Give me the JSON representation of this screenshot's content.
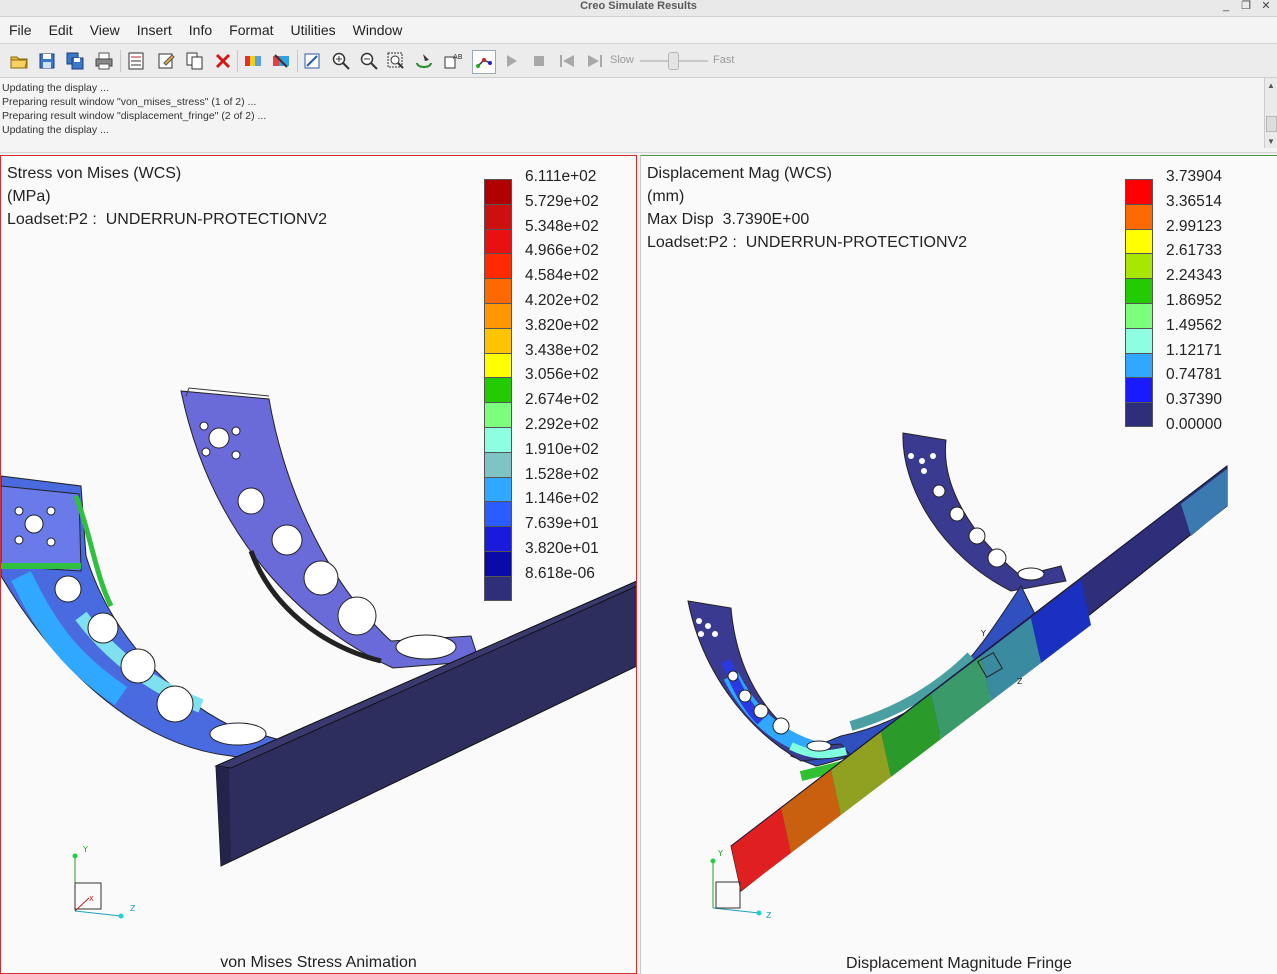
{
  "window": {
    "title": "Creo Simulate Results",
    "controls": [
      "_",
      "❐",
      "✕"
    ]
  },
  "menu": [
    "File",
    "Edit",
    "View",
    "Insert",
    "Info",
    "Format",
    "Utilities",
    "Window"
  ],
  "toolbar": {
    "slow_label": "Slow",
    "fast_label": "Fast",
    "speed_level": 0.5
  },
  "messages": [
    "Updating the display ...",
    "Preparing result window \"von_mises_stress\" (1 of 2) ...",
    "Preparing result window \"displacement_fringe\" (2 of 2) ...",
    "Updating the display ..."
  ],
  "left_pane": {
    "header": [
      "Stress von Mises (WCS)",
      "(MPa)",
      "Loadset:P2 :  UNDERRUN-PROTECTIONV2"
    ],
    "legend_values": [
      "6.111e+02",
      "5.729e+02",
      "5.348e+02",
      "4.966e+02",
      "4.584e+02",
      "4.202e+02",
      "3.820e+02",
      "3.438e+02",
      "3.056e+02",
      "2.674e+02",
      "2.292e+02",
      "1.910e+02",
      "1.528e+02",
      "1.146e+02",
      "7.639e+01",
      "3.820e+01",
      "8.618e-06"
    ],
    "legend_colors": [
      "#b00000",
      "#cc1010",
      "#e81010",
      "#ff2a00",
      "#ff6a00",
      "#ff9800",
      "#ffc400",
      "#ffff00",
      "#22cc00",
      "#7cff7c",
      "#8dffe0",
      "#7fc4c4",
      "#30a8ff",
      "#2b5cff",
      "#1a1adc",
      "#0a0aa8",
      "#2e2e7a"
    ],
    "caption": "von Mises Stress Animation"
  },
  "right_pane": {
    "header": [
      "Displacement Mag (WCS)",
      "(mm)",
      "Max Disp  3.7390E+00",
      "Loadset:P2 :  UNDERRUN-PROTECTIONV2"
    ],
    "legend_values": [
      "3.73904",
      "3.36514",
      "2.99123",
      "2.61733",
      "2.24343",
      "1.86952",
      "1.49562",
      "1.12171",
      "0.74781",
      "0.37390",
      "0.00000"
    ],
    "legend_colors": [
      "#ff0000",
      "#ff6a00",
      "#ffff00",
      "#a8e800",
      "#22cc00",
      "#7cff7c",
      "#8dffe0",
      "#30a8ff",
      "#1a1aff",
      "#2e2e7a"
    ],
    "caption": "Displacement Magnitude Fringe"
  },
  "axis_labels": {
    "y": "Y",
    "z": "Z",
    "x": "X"
  }
}
